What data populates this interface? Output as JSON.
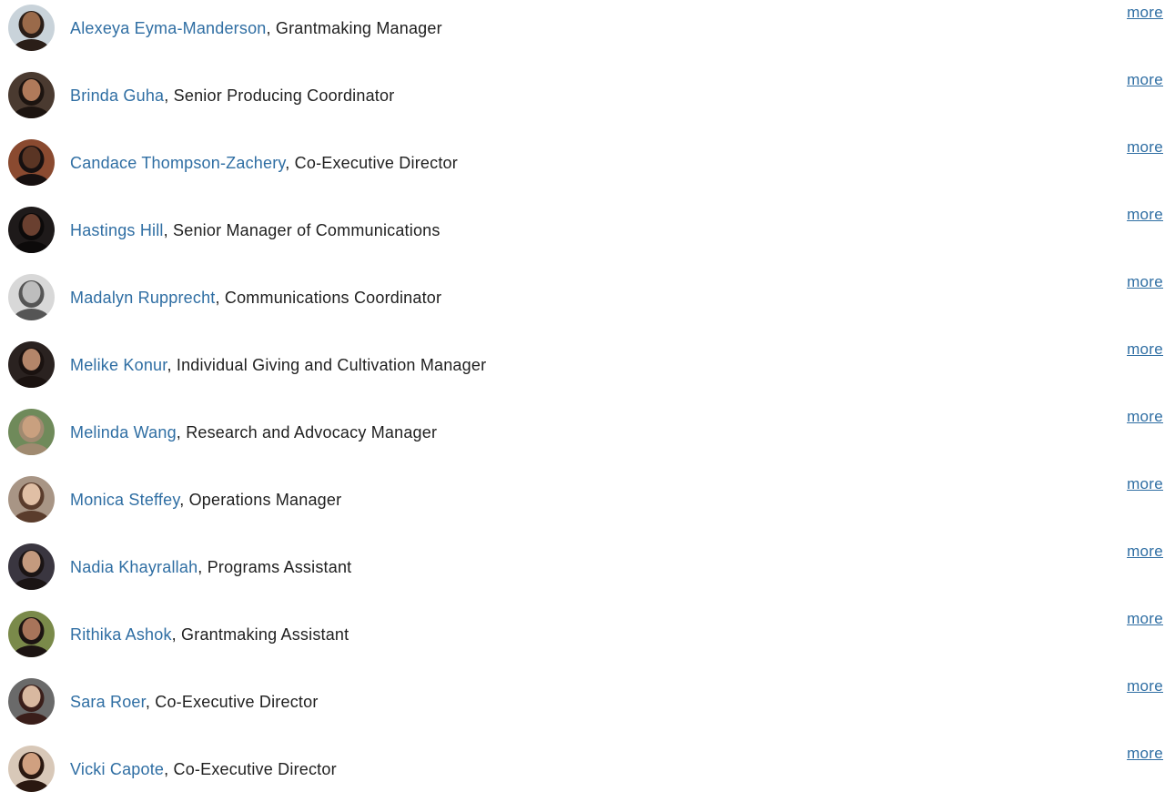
{
  "more_label": "more",
  "staff": [
    {
      "name": "Alexeya Eyma-Manderson",
      "title": ", Grantmaking Manager",
      "avatar": {
        "bg": "#c9d3da",
        "skin": "#9a6a4a",
        "hair": "#2a1e18"
      }
    },
    {
      "name": "Brinda Guha",
      "title": ", Senior Producing Coordinator",
      "avatar": {
        "bg": "#4a3a30",
        "skin": "#b07a5a",
        "hair": "#1c1410"
      }
    },
    {
      "name": "Candace Thompson-Zachery",
      "title": ", Co-Executive Director",
      "avatar": {
        "bg": "#8a4a30",
        "skin": "#5a3524",
        "hair": "#161010"
      }
    },
    {
      "name": "Hastings Hill",
      "title": ", Senior Manager of Communications",
      "avatar": {
        "bg": "#1e1a1a",
        "skin": "#6a4030",
        "hair": "#0c0a0a"
      }
    },
    {
      "name": "Madalyn Rupprecht",
      "title": ", Communications Coordinator",
      "avatar": {
        "bg": "#d8d8d8",
        "skin": "#bdbdbd",
        "hair": "#555555"
      }
    },
    {
      "name": "Melike Konur",
      "title": ", Individual Giving and Cultivation Manager",
      "avatar": {
        "bg": "#2a2220",
        "skin": "#b4866a",
        "hair": "#1a1210"
      }
    },
    {
      "name": "Melinda Wang",
      "title": ", Research and Advocacy Manager",
      "avatar": {
        "bg": "#6f8a5a",
        "skin": "#c9a07f",
        "hair": "#a08a70"
      }
    },
    {
      "name": "Monica Steffey",
      "title": ", Operations Manager",
      "avatar": {
        "bg": "#a89585",
        "skin": "#e0bfa5",
        "hair": "#5a3c2c"
      }
    },
    {
      "name": "Nadia Khayrallah",
      "title": ", Programs Assistant",
      "avatar": {
        "bg": "#3a3640",
        "skin": "#c49a7e",
        "hair": "#1a1414"
      }
    },
    {
      "name": "Rithika Ashok",
      "title": ", Grantmaking Assistant",
      "avatar": {
        "bg": "#7a8a4a",
        "skin": "#a8745a",
        "hair": "#1c1412"
      }
    },
    {
      "name": "Sara Roer",
      "title": ", Co-Executive Director",
      "avatar": {
        "bg": "#6a6a6a",
        "skin": "#d8b8a0",
        "hair": "#3a1e1a"
      }
    },
    {
      "name": "Vicki Capote",
      "title": ", Co-Executive Director",
      "avatar": {
        "bg": "#d8c8b8",
        "skin": "#d0a080",
        "hair": "#2a1810"
      }
    }
  ]
}
